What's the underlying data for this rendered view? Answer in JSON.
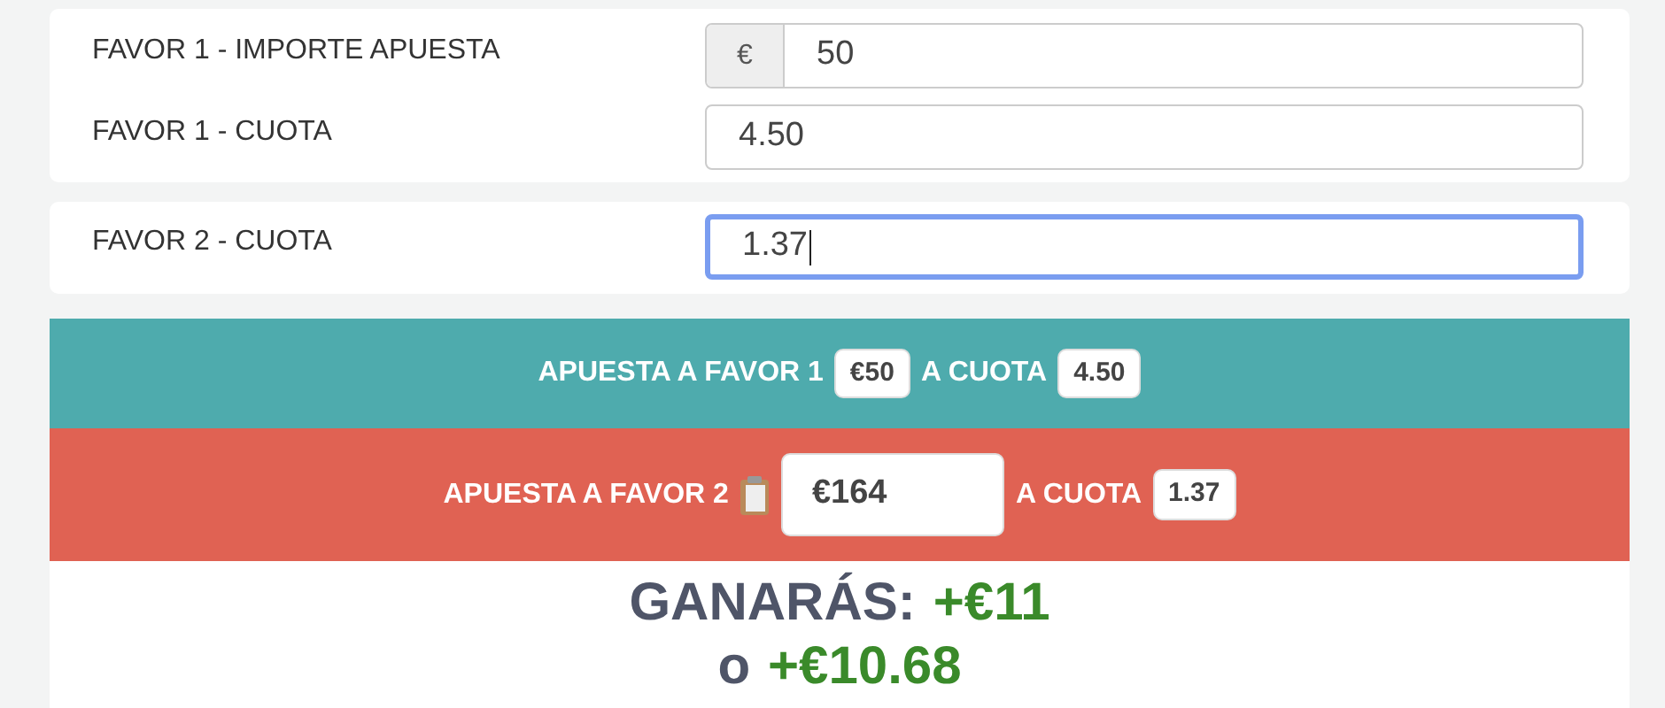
{
  "cards": [
    {
      "fields": [
        {
          "label": "FAVOR 1 - IMPORTE APUESTA",
          "prefix": "€",
          "value": "50",
          "focused": false
        },
        {
          "label": "FAVOR 1 - CUOTA",
          "value": "4.50",
          "focused": false
        }
      ]
    },
    {
      "fields": [
        {
          "label": "FAVOR 2 - CUOTA",
          "value": "1.37",
          "focused": true
        }
      ]
    }
  ],
  "bets": [
    {
      "kind": "fixed",
      "color": "#4eabad",
      "label": "APUESTA A FAVOR 1",
      "amount": "€50",
      "odds_label": "A CUOTA",
      "odds": "4.50"
    },
    {
      "kind": "input",
      "color": "#e06253",
      "label": "APUESTA A FAVOR 2",
      "amount": "€164",
      "odds_label": "A CUOTA",
      "odds": "1.37"
    }
  ],
  "result": {
    "label": "GANARÁS:",
    "profit": "+€11",
    "or_label": "o",
    "exact_profit": "+€10.68"
  }
}
